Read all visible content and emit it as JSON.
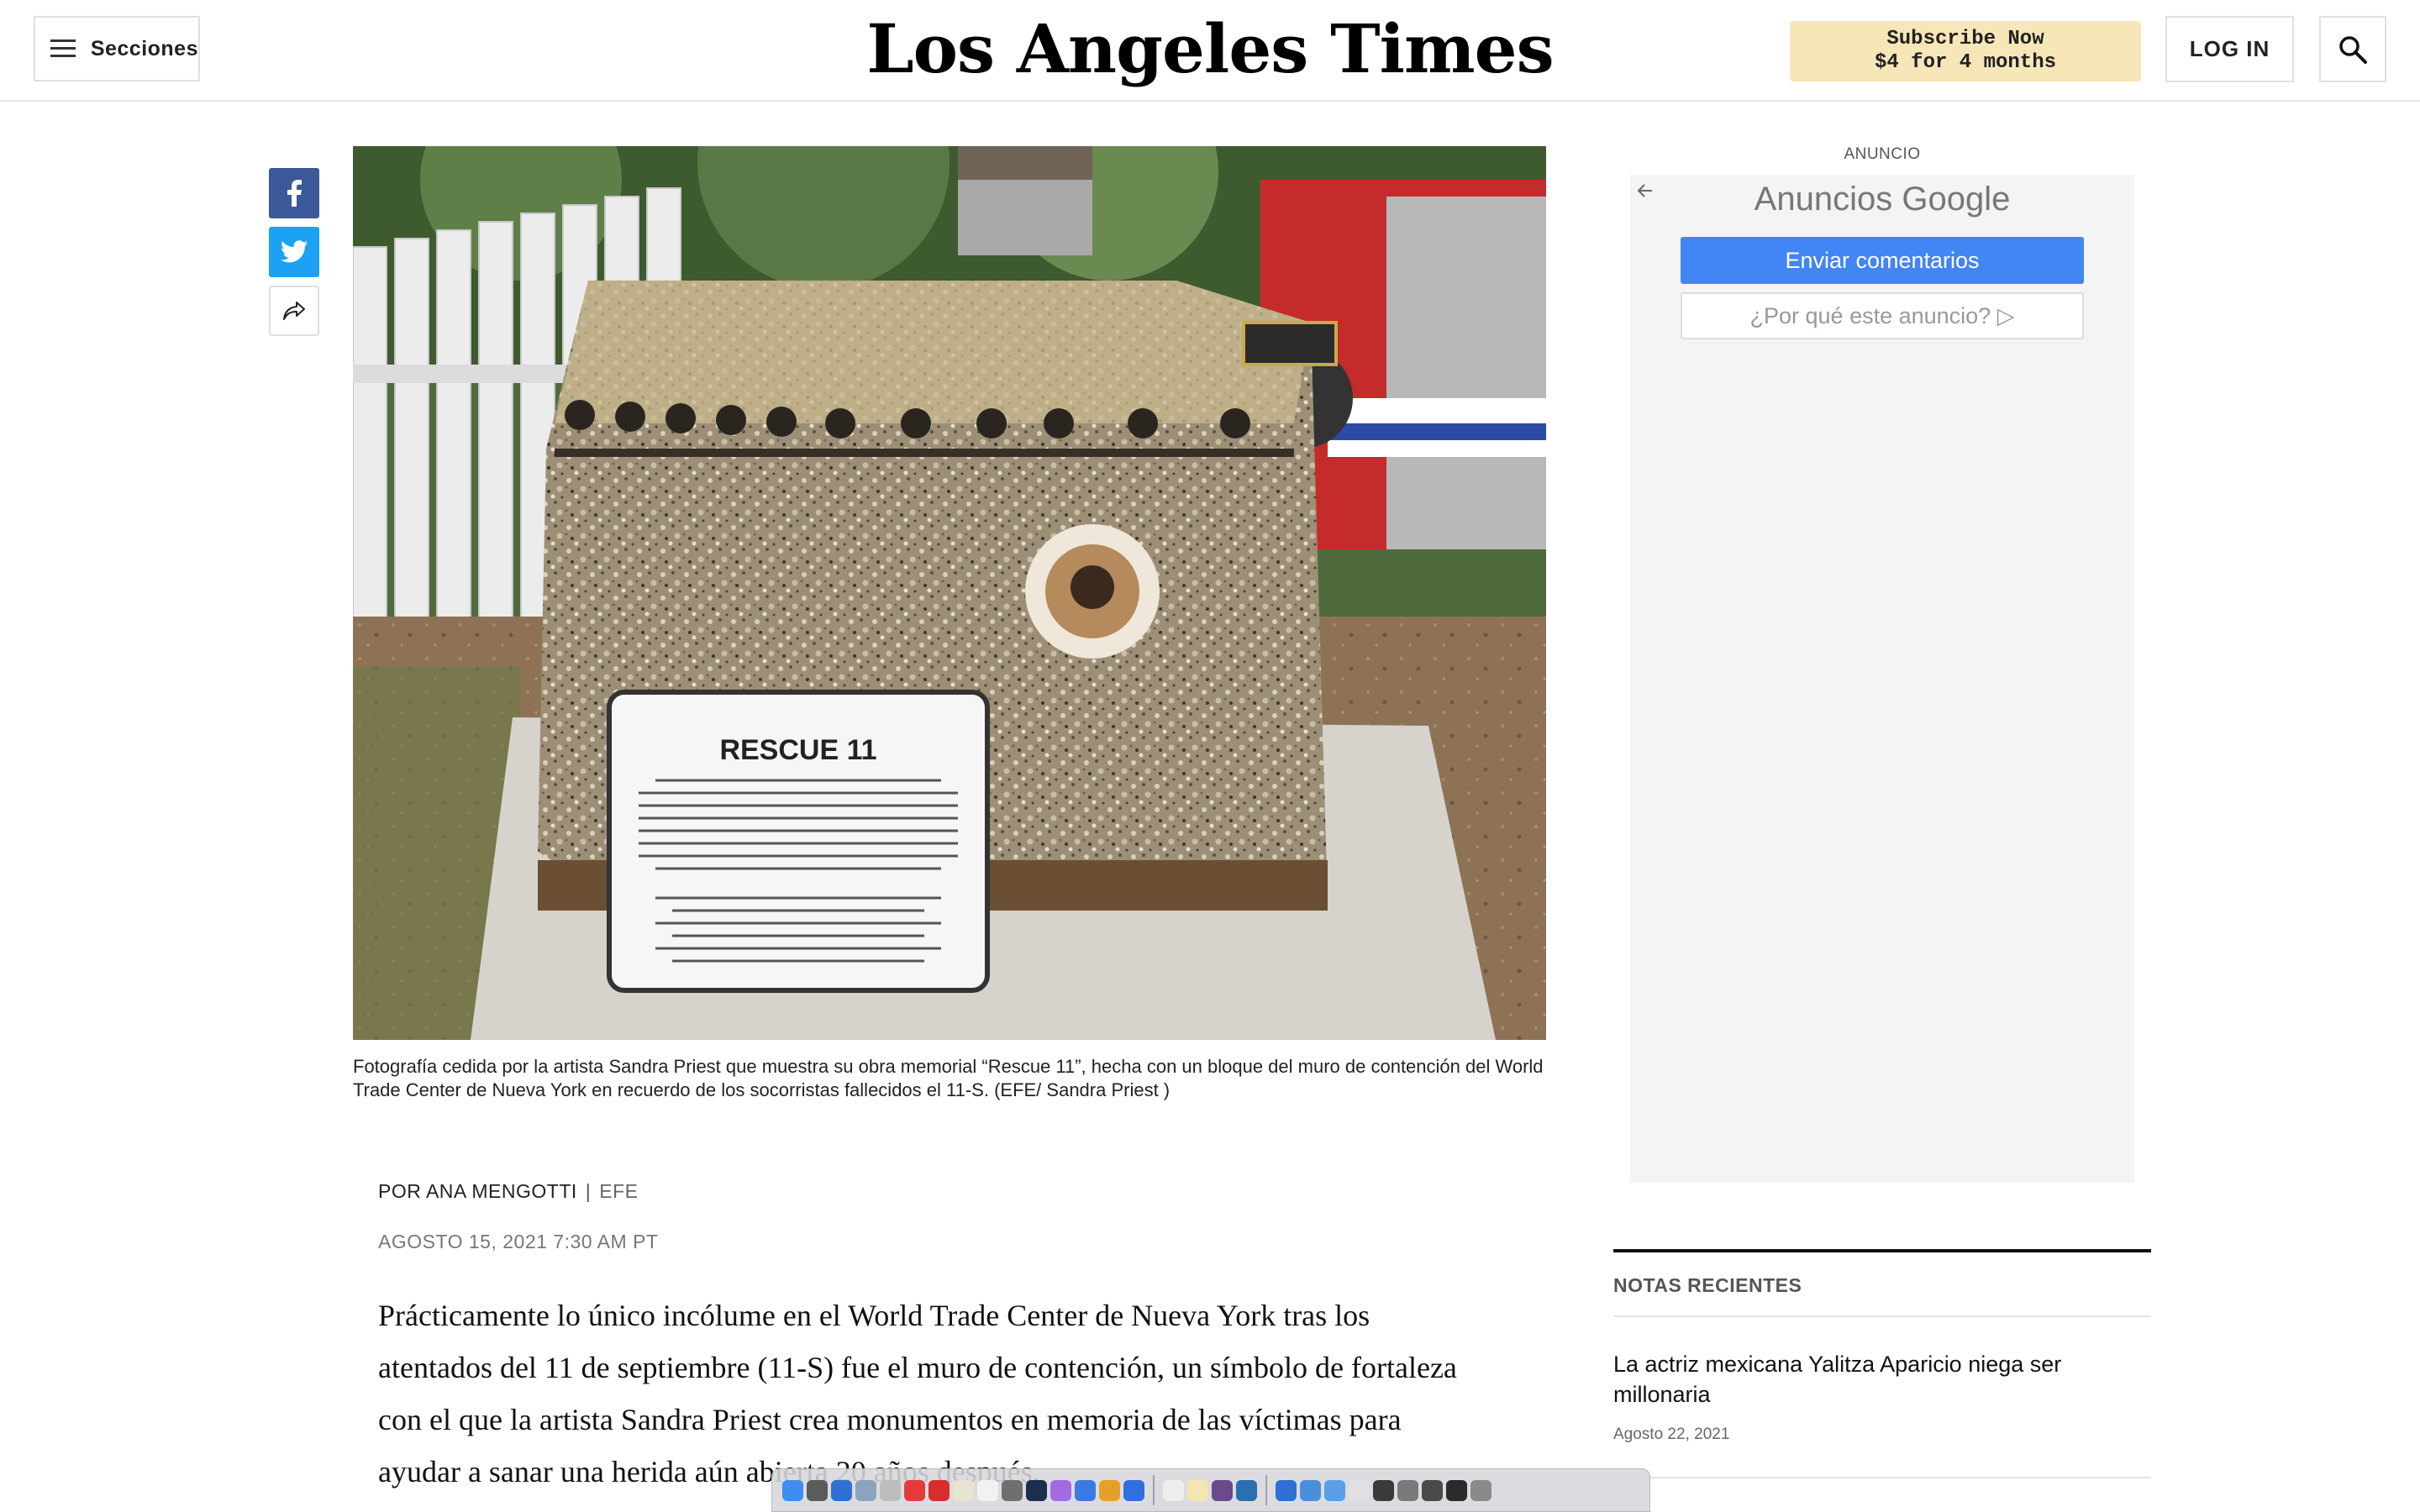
{
  "header": {
    "sections_label": "Secciones",
    "logo_text": "Los Angeles Times",
    "subscribe_line1": "Subscribe Now",
    "subscribe_line2": "$4 for 4 months",
    "login_label": "LOG IN"
  },
  "hero": {
    "plaque_title": "RESCUE 11",
    "caption": "Fotografía cedida por la artista Sandra Priest que muestra su obra memorial “Rescue 11”, hecha con un bloque del muro de contención del World Trade Center de Nueva York en recuerdo de los socorristas fallecidos el 11-S. (EFE/ Sandra Priest )"
  },
  "article": {
    "byline": "POR ANA MENGOTTI",
    "separator": "|",
    "agency": "EFE",
    "date": "AGOSTO 15, 2021 7:30 AM PT",
    "body": "Prácticamente lo único incólume en el World Trade Center de Nueva York tras los atentados del 11 de septiembre (11-S) fue el muro de contención, un símbolo de fortaleza con el que la artista Sandra Priest crea monumentos en memoria de las víctimas para ayudar a sanar una herida aún abierta 20 años después."
  },
  "ad": {
    "label": "ANUNCIO",
    "brand_prefix": "Anuncios",
    "brand_name": "Google",
    "feedback_button": "Enviar comentarios",
    "why_button": "¿Por qué este anuncio? ▷"
  },
  "recent": {
    "title": "NOTAS RECIENTES",
    "items": [
      {
        "headline": "La actriz mexicana Yalitza Aparicio niega ser millonaria",
        "date": "Agosto 22, 2021"
      }
    ]
  },
  "icons": {
    "menu": "hamburger-icon",
    "search": "search-icon",
    "facebook": "facebook-icon",
    "twitter": "twitter-icon",
    "share": "share-icon",
    "back": "arrow-left-icon"
  },
  "colors": {
    "subscribe_bg": "#f7e6b8",
    "facebook": "#3b5998",
    "twitter": "#1da1f2",
    "ad_button": "#4285f4"
  }
}
